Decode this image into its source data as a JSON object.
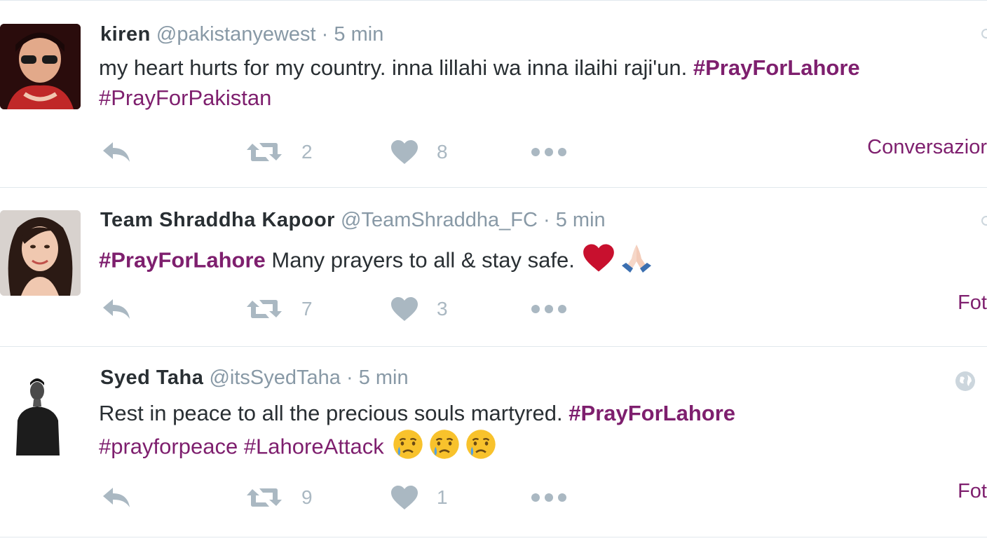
{
  "colors": {
    "hashtag": "#7e1f6e",
    "muted": "#8899a6",
    "action_icon": "#aab8c2",
    "divider": "#e1e8ed"
  },
  "tweets": [
    {
      "name": "kiren",
      "handle": "@pakistanyewest",
      "separator": "·",
      "time": "5 min",
      "text_parts": {
        "p1": "my heart hurts for my country. inna lillahi wa inna ilaihi raji'un. ",
        "tag1": "#PrayForLahore",
        "tag2": "#PrayForPakistan"
      },
      "actions": {
        "retweets": "2",
        "likes": "8"
      },
      "right_link": "Conversazior",
      "icons": [
        "reply-icon",
        "retweet-icon",
        "heart-icon",
        "more-icon"
      ]
    },
    {
      "name": "Team Shraddha Kapoor",
      "handle": "@TeamShraddha_FC",
      "separator": "·",
      "time": "5 min",
      "text_parts": {
        "tag1": "#PrayForLahore",
        "p1": " Many prayers to all & stay safe. "
      },
      "emojis": [
        "red-heart-emoji",
        "folded-hands-emoji"
      ],
      "actions": {
        "retweets": "7",
        "likes": "3"
      },
      "right_link": "Fot",
      "icons": [
        "reply-icon",
        "retweet-icon",
        "heart-icon",
        "more-icon"
      ]
    },
    {
      "name": "Syed Taha",
      "handle": "@itsSyedTaha",
      "separator": "·",
      "time": "5 min",
      "text_parts": {
        "p1": "Rest in peace to all the precious souls martyred. ",
        "tag1": "#PrayForLahore",
        "tag2": "#prayforpeace",
        "tag3": "#LahoreAttack"
      },
      "emojis": [
        "crying-face-emoji",
        "crying-face-emoji",
        "crying-face-emoji"
      ],
      "actions": {
        "retweets": "9",
        "likes": "1"
      },
      "right_link": "Fot",
      "icons": [
        "reply-icon",
        "retweet-icon",
        "heart-icon",
        "more-icon",
        "globe-icon"
      ]
    }
  ]
}
